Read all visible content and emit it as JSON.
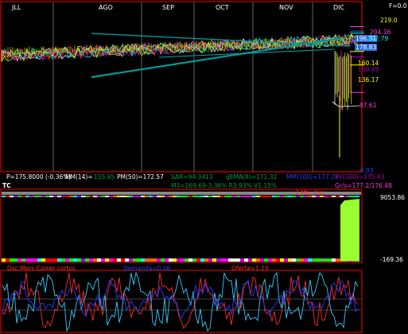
{
  "chart_data": [
    {
      "type": "line",
      "panel": "price",
      "months": [
        "JLL",
        "AGO",
        "SEP",
        "OCT",
        "NOV",
        "DIC"
      ],
      "corner_label": "F=0.0",
      "right_axis_labels": [
        "219.0",
        "204.16",
        "196.31",
        "192.79",
        "178.83",
        "160.14",
        "150.49",
        "136.17",
        "87.61",
        "-0.93"
      ],
      "price_line_values": [
        204.16,
        196.31,
        192.79,
        178.83,
        160.14,
        150.49,
        136.17,
        87.61
      ],
      "indicators": [
        {
          "label": "P=175.8000 (-0.36%)",
          "color": "#ffffff"
        },
        {
          "label": "MM(14)=",
          "color": "#ffffff"
        },
        {
          "label": "155.65",
          "color": "#009a44"
        },
        {
          "label": "PM(50)=172.57",
          "color": "#ffffff"
        },
        {
          "label": "SAR=94.3413",
          "color": "#009a44"
        },
        {
          "label": "gEMA(8)=171.32",
          "color": "#009a44"
        },
        {
          "label": "MM(100)=177.25",
          "color": "#2a3dff"
        },
        {
          "label": "PV(200)=175.43",
          "color": "#b300b3"
        },
        {
          "label": "M3=169.69-3.36% R3.93% V1.15%",
          "color": "#009a44"
        },
        {
          "label": "Gr/s=177.2/176.48",
          "color": "#ff3ad8"
        }
      ]
    },
    {
      "type": "area",
      "panel": "volume",
      "title": "TC",
      "flag": "3 Mb. Osc.",
      "axis_max": "9053.86",
      "axis_min": "-169.36"
    },
    {
      "type": "line",
      "panel": "oscillator",
      "legend": [
        {
          "label": "Osc.Merc.Correr cortos",
          "color": "#ff2a2a"
        },
        {
          "label": "Demanda=0.06",
          "color": "#2a3dff"
        },
        {
          "label": "Oferta=1.15",
          "color": "#ff2a2a"
        }
      ]
    }
  ],
  "colors": {
    "background": "#000000",
    "frame": "#ff0000",
    "grid": "#ffffff",
    "price_yellow": "#ffff00",
    "teal_trend": "#009a9a",
    "green_volume": "#99ff33",
    "osc_red": "#ff2a2a",
    "osc_cyan": "#33ccff"
  }
}
